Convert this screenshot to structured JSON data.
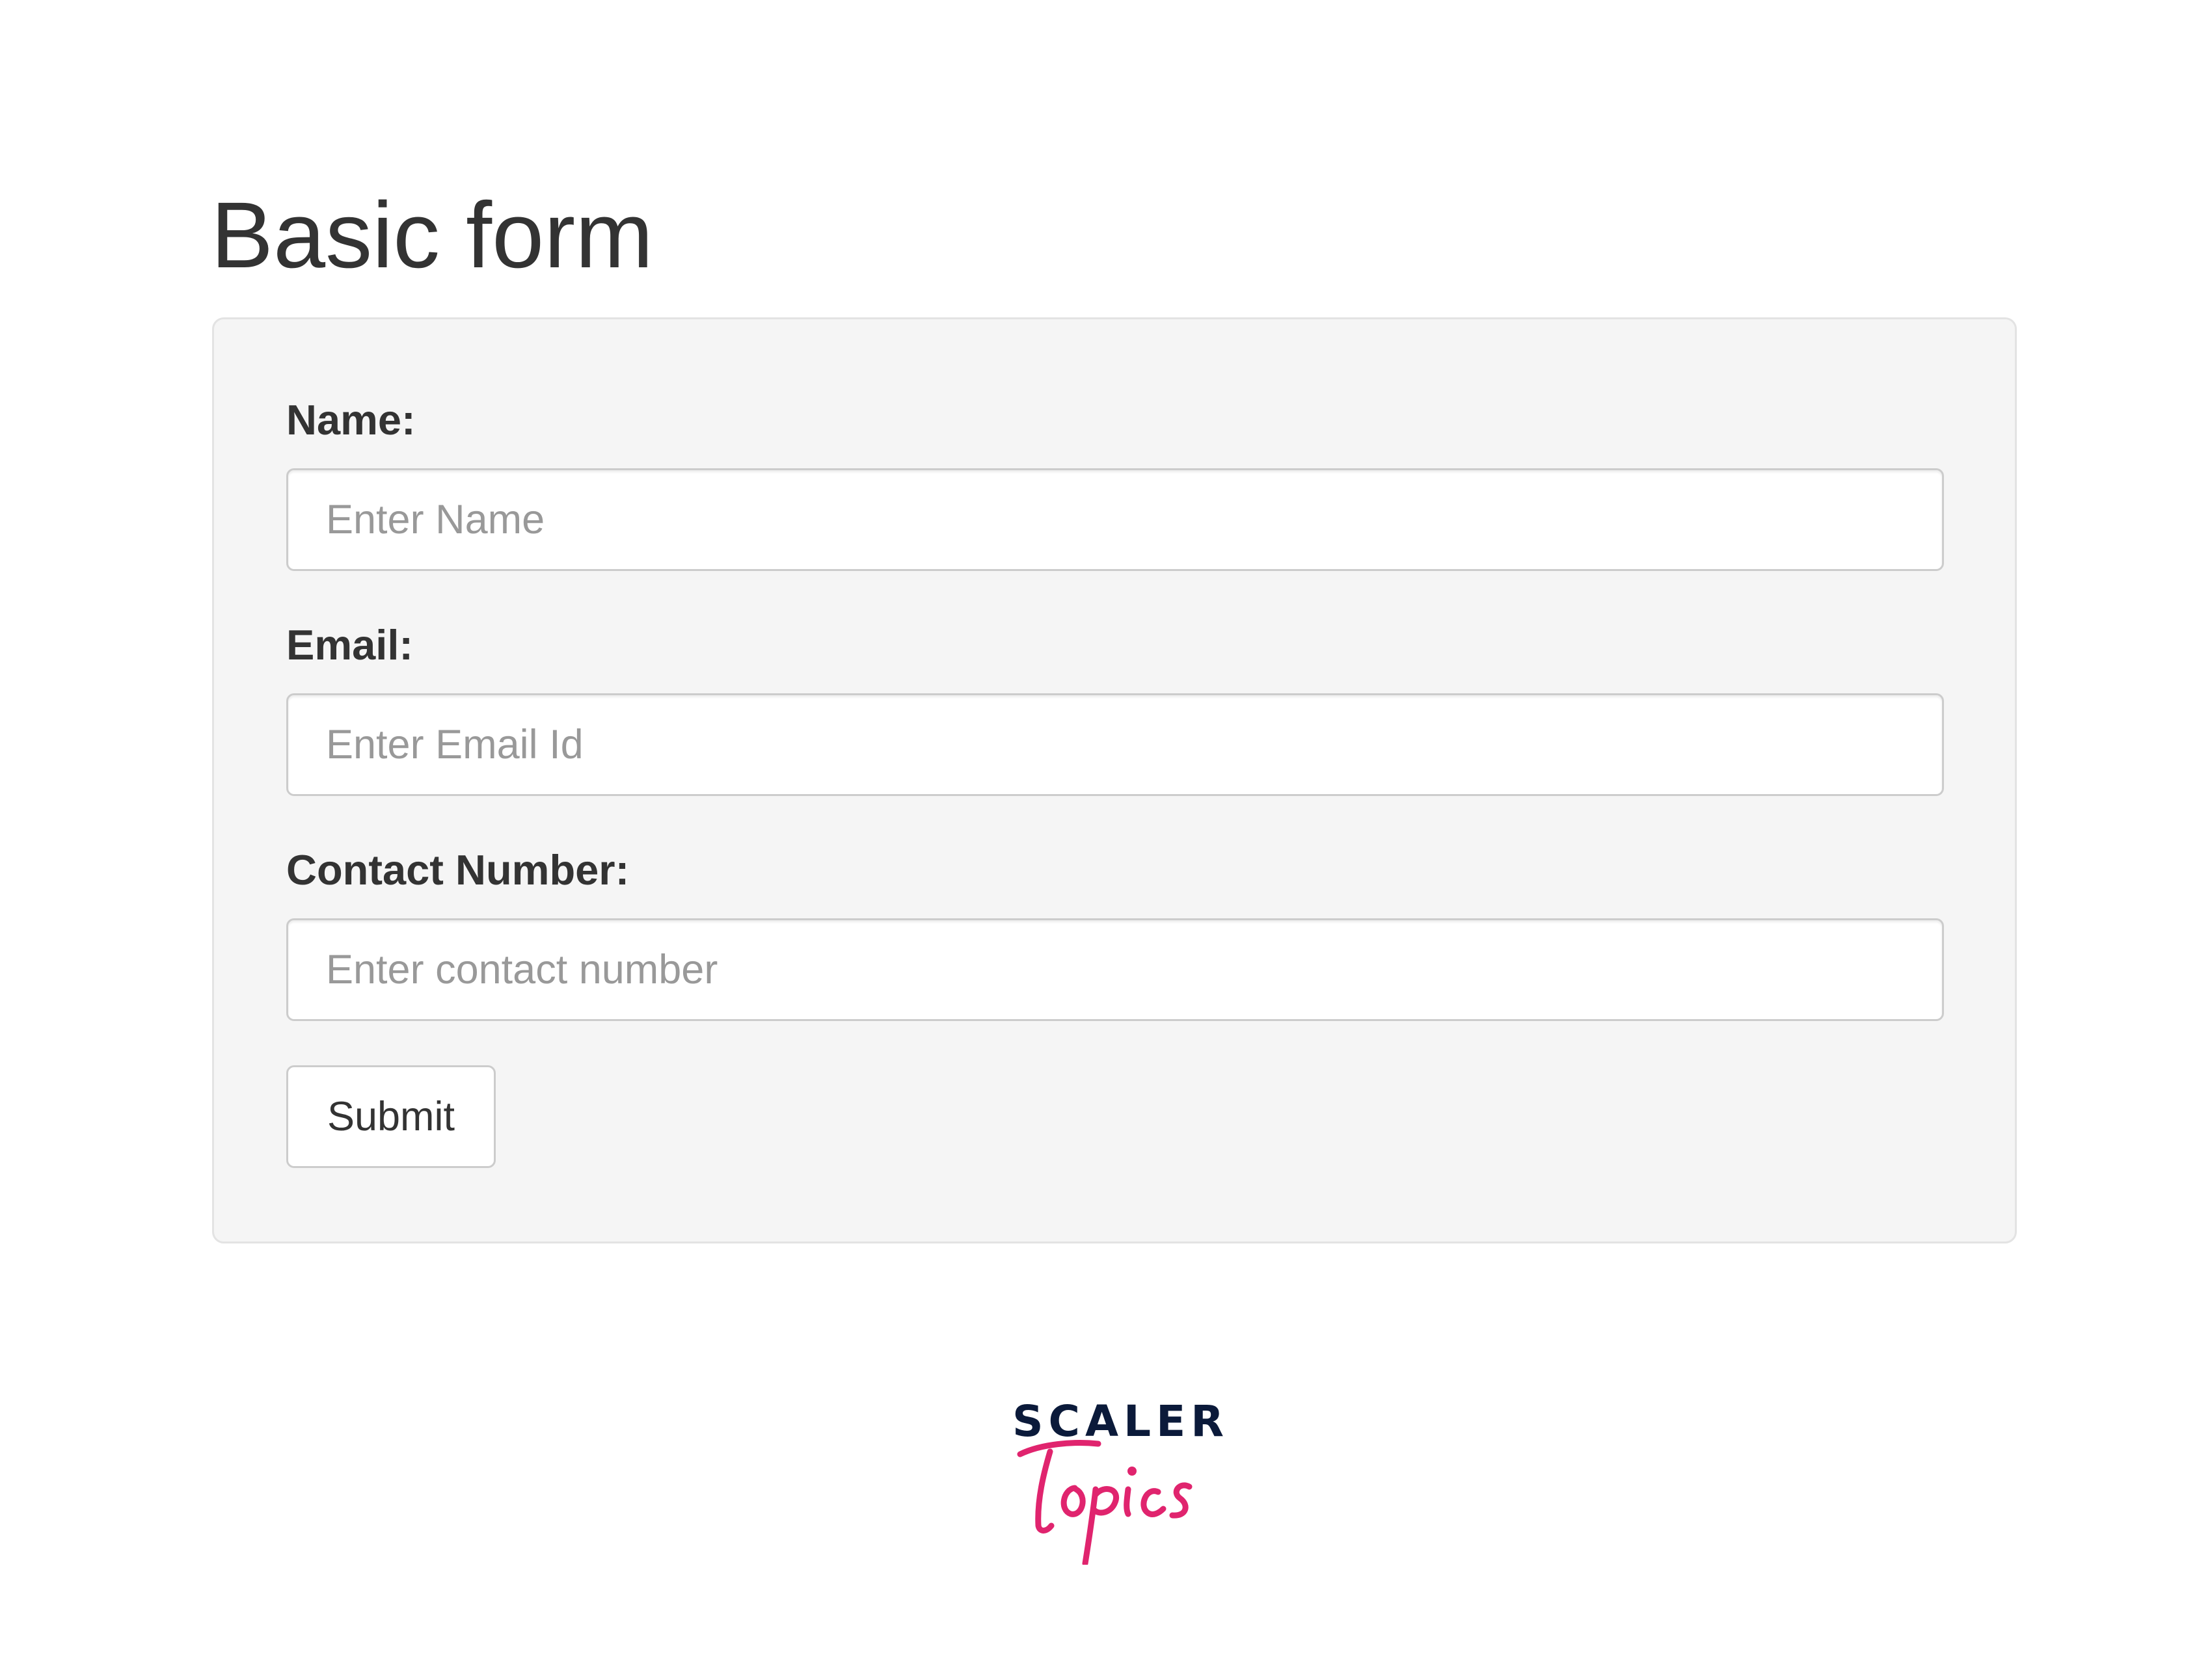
{
  "page": {
    "title": "Basic form"
  },
  "form": {
    "fields": [
      {
        "label": "Name:",
        "placeholder": "Enter Name",
        "value": ""
      },
      {
        "label": "Email:",
        "placeholder": "Enter Email Id",
        "value": ""
      },
      {
        "label": "Contact Number:",
        "placeholder": "Enter contact number",
        "value": ""
      }
    ],
    "submit_label": "Submit"
  },
  "brand": {
    "word": "SCALER",
    "script": "Topics",
    "colors": {
      "word": "#0b1a3a",
      "script": "#e0246e"
    }
  },
  "colors": {
    "well_background": "#f5f5f5",
    "well_border": "#e3e3e3",
    "input_border": "#cccccc",
    "text": "#333333",
    "placeholder": "#999999"
  }
}
